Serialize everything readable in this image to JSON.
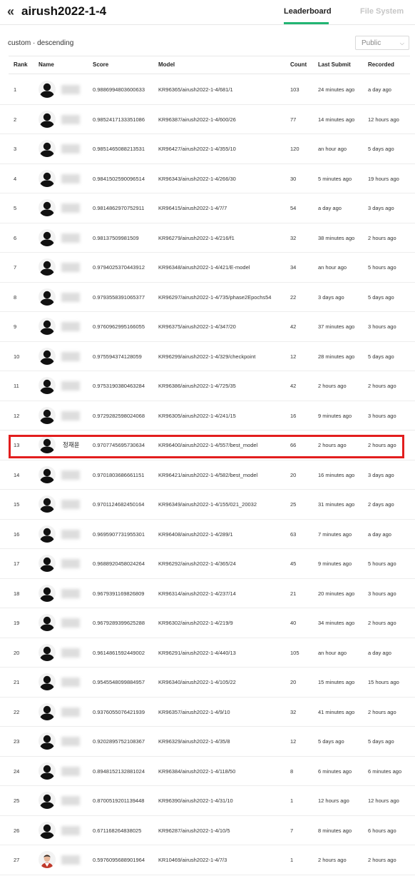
{
  "header": {
    "back_icon": "double-chevron-left-icon",
    "title": "airush2022-1-4",
    "tabs": [
      {
        "label": "Leaderboard",
        "active": true
      },
      {
        "label": "File System",
        "active": false
      }
    ],
    "accent": "#22b573"
  },
  "sort": {
    "label": "custom · descending",
    "visibility_select": "Public"
  },
  "columns": [
    "Rank",
    "Name",
    "Score",
    "Model",
    "Count",
    "Last Submit",
    "Recorded"
  ],
  "rows": [
    {
      "rank": "1",
      "name": "",
      "avatar": "default-user-icon",
      "score": "0.9886994803600633",
      "model": "KR96365/airush2022-1-4/681/1",
      "count": "103",
      "last_submit": "24 minutes ago",
      "recorded": "a day ago"
    },
    {
      "rank": "2",
      "name": "",
      "avatar": "default-user-icon",
      "score": "0.9852417133351086",
      "model": "KR96387/airush2022-1-4/600/26",
      "count": "77",
      "last_submit": "14 minutes ago",
      "recorded": "12 hours ago"
    },
    {
      "rank": "3",
      "name": "",
      "avatar": "default-user-icon",
      "score": "0.9851465088213531",
      "model": "KR96427/airush2022-1-4/355/10",
      "count": "120",
      "last_submit": "an hour ago",
      "recorded": "5 days ago"
    },
    {
      "rank": "4",
      "name": "",
      "avatar": "default-user-icon",
      "score": "0.9841502590096514",
      "model": "KR96343/airush2022-1-4/266/30",
      "count": "30",
      "last_submit": "5 minutes ago",
      "recorded": "19 hours ago"
    },
    {
      "rank": "5",
      "name": "",
      "avatar": "default-user-icon",
      "score": "0.9814862970752911",
      "model": "KR96415/airush2022-1-4/7/7",
      "count": "54",
      "last_submit": "a day ago",
      "recorded": "3 days ago"
    },
    {
      "rank": "6",
      "name": "",
      "avatar": "default-user-icon",
      "score": "0.98137509981509",
      "model": "KR96279/airush2022-1-4/216/f1",
      "count": "32",
      "last_submit": "38 minutes ago",
      "recorded": "2 hours ago"
    },
    {
      "rank": "7",
      "name": "",
      "avatar": "default-user-icon",
      "score": "0.9794025370443912",
      "model": "KR96348/airush2022-1-4/421/E-model",
      "count": "34",
      "last_submit": "an hour ago",
      "recorded": "5 hours ago"
    },
    {
      "rank": "8",
      "name": "",
      "avatar": "default-user-icon",
      "score": "0.9793558391065377",
      "model": "KR96297/airush2022-1-4/735/phase2Epochs54",
      "count": "22",
      "last_submit": "3 days ago",
      "recorded": "5 days ago"
    },
    {
      "rank": "9",
      "name": "",
      "avatar": "default-user-icon",
      "score": "0.9760962995166055",
      "model": "KR96375/airush2022-1-4/347/20",
      "count": "42",
      "last_submit": "37 minutes ago",
      "recorded": "3 hours ago"
    },
    {
      "rank": "10",
      "name": "",
      "avatar": "default-user-icon",
      "score": "0.975594374128059",
      "model": "KR96299/airush2022-1-4/329/checkpoint",
      "count": "12",
      "last_submit": "28 minutes ago",
      "recorded": "5 days ago"
    },
    {
      "rank": "11",
      "name": "",
      "avatar": "default-user-icon",
      "score": "0.9753190380463284",
      "model": "KR96386/airush2022-1-4/725/35",
      "count": "42",
      "last_submit": "2 hours ago",
      "recorded": "2 hours ago"
    },
    {
      "rank": "12",
      "name": "",
      "avatar": "default-user-icon",
      "score": "0.9729282598024068",
      "model": "KR96305/airush2022-1-4/241/15",
      "count": "16",
      "last_submit": "9 minutes ago",
      "recorded": "3 hours ago"
    },
    {
      "rank": "13",
      "name": "정재윤",
      "avatar": "default-user-icon",
      "score": "0.9707745695730634",
      "model": "KR96400/airush2022-1-4/557/best_model",
      "count": "66",
      "last_submit": "2 hours ago",
      "recorded": "2 hours ago",
      "highlighted": true
    },
    {
      "rank": "14",
      "name": "",
      "avatar": "default-user-icon",
      "score": "0.9701803686661151",
      "model": "KR96421/airush2022-1-4/582/best_model",
      "count": "20",
      "last_submit": "16 minutes ago",
      "recorded": "3 days ago"
    },
    {
      "rank": "15",
      "name": "",
      "avatar": "default-user-icon",
      "score": "0.9701124682450164",
      "model": "KR96349/airush2022-1-4/155/021_20032",
      "count": "25",
      "last_submit": "31 minutes ago",
      "recorded": "2 days ago"
    },
    {
      "rank": "16",
      "name": "",
      "avatar": "default-user-icon",
      "score": "0.9695907731955301",
      "model": "KR96408/airush2022-1-4/289/1",
      "count": "63",
      "last_submit": "7 minutes ago",
      "recorded": "a day ago"
    },
    {
      "rank": "17",
      "name": "",
      "avatar": "default-user-icon",
      "score": "0.9688920458024264",
      "model": "KR96292/airush2022-1-4/365/24",
      "count": "45",
      "last_submit": "9 minutes ago",
      "recorded": "5 hours ago"
    },
    {
      "rank": "18",
      "name": "",
      "avatar": "default-user-icon",
      "score": "0.9679391169826809",
      "model": "KR96314/airush2022-1-4/237/14",
      "count": "21",
      "last_submit": "20 minutes ago",
      "recorded": "3 hours ago"
    },
    {
      "rank": "19",
      "name": "",
      "avatar": "default-user-icon",
      "score": "0.9679289399625288",
      "model": "KR96302/airush2022-1-4/219/9",
      "count": "40",
      "last_submit": "34 minutes ago",
      "recorded": "2 hours ago"
    },
    {
      "rank": "20",
      "name": "",
      "avatar": "default-user-icon",
      "score": "0.9614861592449002",
      "model": "KR96291/airush2022-1-4/440/13",
      "count": "105",
      "last_submit": "an hour ago",
      "recorded": "a day ago"
    },
    {
      "rank": "21",
      "name": "",
      "avatar": "default-user-icon",
      "score": "0.9545548099884957",
      "model": "KR96340/airush2022-1-4/105/22",
      "count": "20",
      "last_submit": "15 minutes ago",
      "recorded": "15 hours ago"
    },
    {
      "rank": "22",
      "name": "",
      "avatar": "default-user-icon",
      "score": "0.9376055076421939",
      "model": "KR96357/airush2022-1-4/9/10",
      "count": "32",
      "last_submit": "41 minutes ago",
      "recorded": "2 hours ago"
    },
    {
      "rank": "23",
      "name": "",
      "avatar": "default-user-icon",
      "score": "0.9202895752108367",
      "model": "KR96329/airush2022-1-4/35/8",
      "count": "12",
      "last_submit": "5 days ago",
      "recorded": "5 days ago"
    },
    {
      "rank": "24",
      "name": "",
      "avatar": "default-user-icon",
      "score": "0.8948152132881024",
      "model": "KR96384/airush2022-1-4/118/50",
      "count": "8",
      "last_submit": "6 minutes ago",
      "recorded": "6 minutes ago"
    },
    {
      "rank": "25",
      "name": "",
      "avatar": "default-user-icon",
      "score": "0.8700519201139448",
      "model": "KR96390/airush2022-1-4/31/10",
      "count": "1",
      "last_submit": "12 hours ago",
      "recorded": "12 hours ago"
    },
    {
      "rank": "26",
      "name": "",
      "avatar": "default-user-icon",
      "score": "0.671168264838025",
      "model": "KR96287/airush2022-1-4/10/5",
      "count": "7",
      "last_submit": "8 minutes ago",
      "recorded": "6 hours ago"
    },
    {
      "rank": "27",
      "name": "",
      "avatar": "profile-photo",
      "score": "0.5976095688901964",
      "model": "KR10469/airush2022-1-4/7/3",
      "count": "1",
      "last_submit": "2 hours ago",
      "recorded": "2 hours ago"
    }
  ]
}
